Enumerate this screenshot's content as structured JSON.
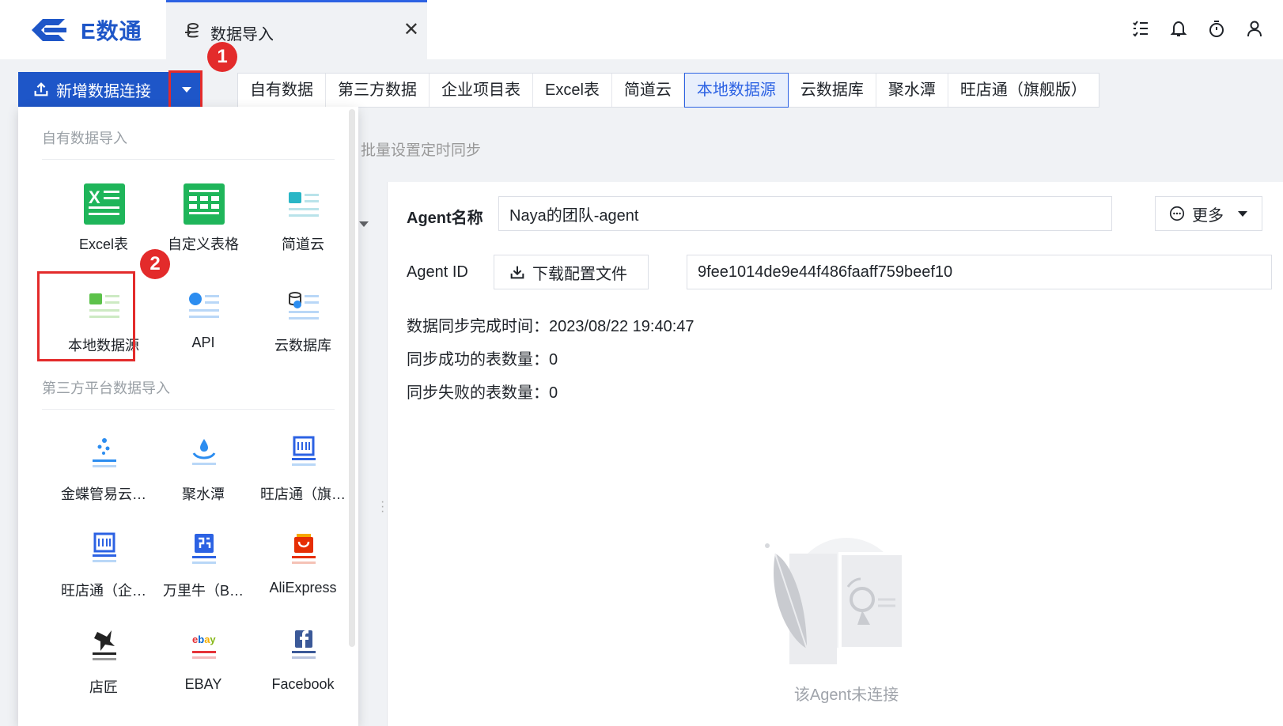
{
  "app": {
    "brand": "E数通",
    "active_tab": "数据导入",
    "brand_color": "#1e56c8"
  },
  "top_icons": [
    "task-list-icon",
    "bell-icon",
    "timer-icon",
    "user-icon"
  ],
  "toolbar": {
    "new_connection_label": "新增数据连接",
    "batch_sync_label": "批量设置定时同步",
    "annotation_1": "1",
    "annotation_2": "2",
    "filter_tabs": [
      {
        "label": "自有数据",
        "active": false
      },
      {
        "label": "第三方数据",
        "active": false
      },
      {
        "label": "企业项目表",
        "active": false
      },
      {
        "label": "Excel表",
        "active": false
      },
      {
        "label": "简道云",
        "active": false
      },
      {
        "label": "本地数据源",
        "active": true
      },
      {
        "label": "云数据库",
        "active": false
      },
      {
        "label": "聚水潭",
        "active": false
      },
      {
        "label": "旺店通（旗舰版）",
        "active": false
      }
    ]
  },
  "dropdown": {
    "own_section_title": "自有数据导入",
    "third_section_title": "第三方平台数据导入",
    "own_items": [
      {
        "label": "Excel表",
        "icon": "excel-icon"
      },
      {
        "label": "自定义表格",
        "icon": "custom-table-icon"
      },
      {
        "label": "简道云",
        "icon": "jiandaoyun-icon"
      },
      {
        "label": "本地数据源",
        "icon": "local-datasource-icon"
      },
      {
        "label": "API",
        "icon": "api-icon"
      },
      {
        "label": "云数据库",
        "icon": "cloud-database-icon"
      }
    ],
    "third_items": [
      {
        "label": "金蝶管易云…",
        "icon": "kingdee-icon"
      },
      {
        "label": "聚水潭",
        "icon": "jushuitan-icon"
      },
      {
        "label": "旺店通（旗…",
        "icon": "wangdiantong-icon"
      },
      {
        "label": "旺店通（企…",
        "icon": "wangdiantong-enterprise-icon"
      },
      {
        "label": "万里牛（B…",
        "icon": "wanliniu-icon"
      },
      {
        "label": "AliExpress",
        "icon": "aliexpress-icon"
      },
      {
        "label": "店匠",
        "icon": "dianjiang-icon"
      },
      {
        "label": "EBAY",
        "icon": "ebay-icon"
      },
      {
        "label": "Facebook",
        "icon": "facebook-icon"
      }
    ]
  },
  "agent": {
    "name_label": "Agent名称",
    "name_value": "Naya的团队-agent",
    "more_label": "更多",
    "id_label": "Agent ID",
    "download_label": "下载配置文件",
    "id_value": "9fee1014de9e44f486faaff759beef10",
    "sync_time_label": "数据同步完成时间：2023/08/22 19:40:47",
    "success_count_label": "同步成功的表数量：0",
    "fail_count_label": "同步失败的表数量：0",
    "empty_text": "该Agent未连接"
  }
}
